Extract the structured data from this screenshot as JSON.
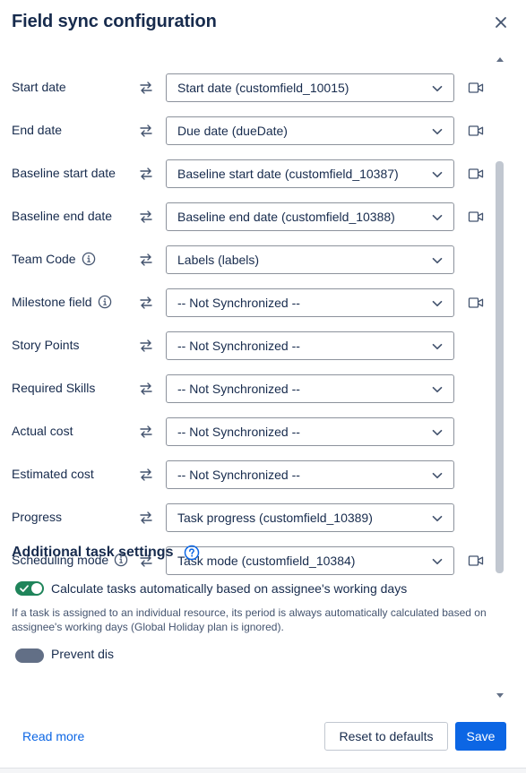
{
  "dialog": {
    "title": "Field sync configuration",
    "close_icon": "close-icon"
  },
  "fields": [
    {
      "label": "Start date",
      "info": false,
      "value": "Start date (customfield_10015)",
      "camera": true
    },
    {
      "label": "End date",
      "info": false,
      "value": "Due date (dueDate)",
      "camera": true
    },
    {
      "label": "Baseline start date",
      "info": false,
      "value": "Baseline start date (customfield_10387)",
      "camera": true
    },
    {
      "label": "Baseline end date",
      "info": false,
      "value": "Baseline end date (customfield_10388)",
      "camera": true
    },
    {
      "label": "Team Code",
      "info": true,
      "value": "Labels (labels)",
      "camera": false
    },
    {
      "label": "Milestone field",
      "info": true,
      "value": "-- Not Synchronized --",
      "camera": true
    },
    {
      "label": "Story Points",
      "info": false,
      "value": "-- Not Synchronized --",
      "camera": false
    },
    {
      "label": "Required Skills",
      "info": false,
      "value": "-- Not Synchronized --",
      "camera": false
    },
    {
      "label": "Actual cost",
      "info": false,
      "value": "-- Not Synchronized --",
      "camera": false
    },
    {
      "label": "Estimated cost",
      "info": false,
      "value": "-- Not Synchronized --",
      "camera": false
    },
    {
      "label": "Progress",
      "info": false,
      "value": "Task progress (customfield_10389)",
      "camera": false
    },
    {
      "label": "Scheduling mode",
      "info": true,
      "value": "Task mode (customfield_10384)",
      "camera": true
    }
  ],
  "additional": {
    "title": "Additional task settings",
    "help_icon": "question-circle-icon",
    "toggle_label": "Calculate tasks automatically based on assignee's working days",
    "toggle_on": true,
    "toggle_help": "If a task is assigned to an individual resource, its period is always automatically calculated based on assignee's working days (Global Holiday plan is ignored).",
    "toggle2_label": "Prevent dis",
    "toggle2_on": false
  },
  "footer": {
    "read_more": "Read more",
    "reset_label": "Reset to defaults",
    "save_label": "Save"
  },
  "colors": {
    "primary": "#0c66e4",
    "toggle_on": "#1f845a",
    "text": "#172b4d"
  }
}
